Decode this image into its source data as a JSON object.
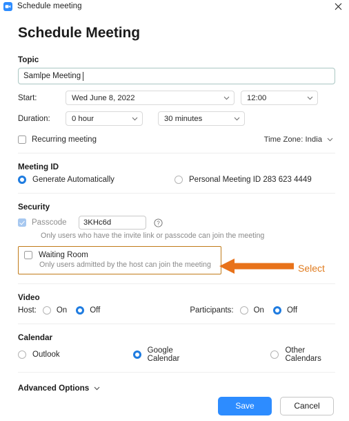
{
  "window": {
    "titlebar_text": "Schedule meeting",
    "app_icon": "zoom-camera-icon",
    "close_icon": "close-icon"
  },
  "page_title": "Schedule Meeting",
  "topic": {
    "label": "Topic",
    "value": "Samlpe Meeting",
    "placeholder": "Topic"
  },
  "start": {
    "label": "Start:",
    "date_value": "Wed  June  8,  2022",
    "time_value": "12:00"
  },
  "duration": {
    "label": "Duration:",
    "hour_value": "0 hour",
    "minute_value": "30 minutes"
  },
  "recurring": {
    "label": "Recurring meeting",
    "checked": false
  },
  "timezone": {
    "label": "Time Zone: India"
  },
  "meeting_id": {
    "section_title": "Meeting ID",
    "generate_label": "Generate Automatically",
    "personal_label": "Personal Meeting ID 283 623 4449",
    "selected": "generate"
  },
  "security": {
    "section_title": "Security",
    "passcode_label": "Passcode",
    "passcode_value": "3KHc6d",
    "passcode_hint": "Only users who have the invite link or passcode can join the meeting",
    "help_icon": "question-mark-icon",
    "waiting_room_label": "Waiting Room",
    "waiting_room_hint": "Only users admitted by the host can join the meeting",
    "waiting_room_checked": false,
    "highlight_color": "#c07a18"
  },
  "annotation": {
    "text": "Select",
    "color": "#e07b1e",
    "arrow_icon": "left-arrow-icon"
  },
  "video": {
    "section_title": "Video",
    "host_label": "Host:",
    "participants_label": "Participants:",
    "on_label": "On",
    "off_label": "Off",
    "host_selected": "off",
    "participants_selected": "off"
  },
  "calendar": {
    "section_title": "Calendar",
    "outlook_label": "Outlook",
    "google_label": "Google Calendar",
    "other_label": "Other Calendars",
    "selected": "google"
  },
  "advanced": {
    "label": "Advanced Options",
    "chevron_icon": "chevron-down-icon"
  },
  "footer": {
    "save_label": "Save",
    "cancel_label": "Cancel",
    "save_color": "#2d8cff"
  }
}
